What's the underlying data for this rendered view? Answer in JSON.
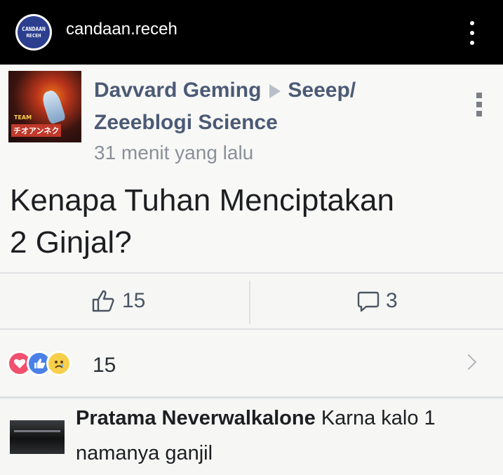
{
  "instagram": {
    "avatar_line1": "CANDAAN",
    "avatar_line2": "RECEH",
    "username": "candaan.receh"
  },
  "post": {
    "thumbnail_line1": "TEAM",
    "thumbnail_line2": "チオアンネク",
    "author": "Davvard Geming",
    "group_part1": "Seeep/",
    "group_part2": "Zeeeblogi Science",
    "time": "31 menit yang lalu",
    "text_line1": "Kenapa Tuhan Menciptakan",
    "text_line2": "2 Ginjal?",
    "likes": "15",
    "comments": "3",
    "reactions_count": "15",
    "icons": [
      "thumbs-up-outline-icon",
      "comment-bubble-icon",
      "love-reaction-icon",
      "like-reaction-icon",
      "sad-reaction-icon",
      "chevron-right-icon",
      "more-vertical-icon"
    ]
  },
  "comment": {
    "author": "Pratama Neverwalkalone",
    "text": "Karna kalo 1 namanya ganjil"
  },
  "colors": {
    "header_bg": "#000000",
    "author_color": "#4b5a75",
    "love": "#f0506e",
    "like": "#4a80e8",
    "sad": "#f7cf4a"
  }
}
